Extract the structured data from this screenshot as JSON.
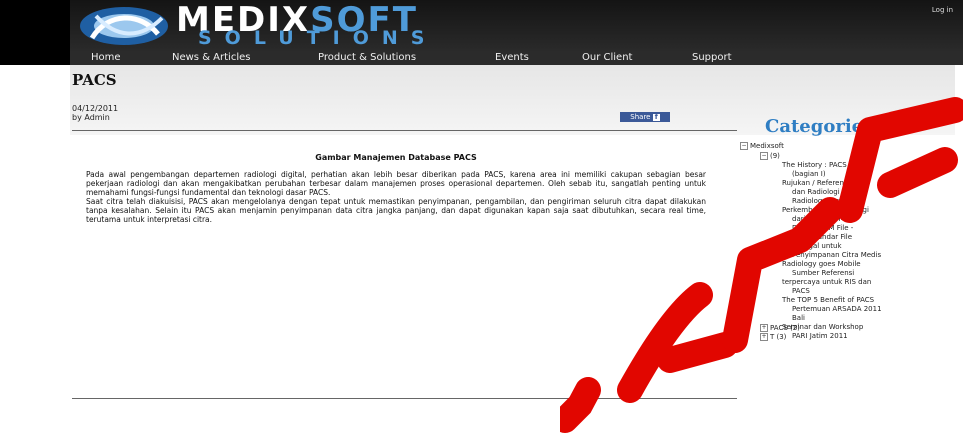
{
  "header": {
    "brand_part1": "MEDIX",
    "brand_part2": "SOFT",
    "brand_sub": "SOLUTIONS",
    "login_label": "Log in"
  },
  "nav": [
    "Home",
    "News & Articles",
    "Product & Solutions",
    "Events",
    "Our Client",
    "Support"
  ],
  "page": {
    "title": "PACS",
    "date": "04/12/2011",
    "author": "by Admin",
    "share_label": "Share"
  },
  "article": {
    "title": "Gambar Manajemen Database PACS",
    "paragraph1": "Pada awal pengembangan departemen radiologi digital, perhatian akan lebih besar diberikan pada PACS, karena area ini memiliki cakupan sebagian besar pekerjaan radiologi dan akan mengakibatkan perubahan terbesar dalam manajemen proses operasional departemen. Oleh sebab itu, sangatlah penting untuk memahami fungsi-fungsi fundamental dan teknologi dasar PACS.",
    "paragraph2": "Saat citra telah diakuisisi, PACS akan mengelolanya dengan tepat untuk memastikan penyimpanan, pengambilan, dan pengiriman seluruh citra dapat dilakukan tanpa kesalahan. Selain itu PACS akan menjamin penyimpanan data citra jangka panjang, dan dapat digunakan kapan saja saat dibutuhkan, secara real time, terutama untuk interpretasi citra."
  },
  "sidebar": {
    "title": "Categories",
    "tree": [
      {
        "label": "Medixsoft"
      },
      {
        "label": "(9)"
      },
      {
        "label": "The History : PACS"
      },
      {
        "label": "(bagian I)"
      },
      {
        "label": "Rujukan / Referensi PACS"
      },
      {
        "label": "dan Radiologi"
      },
      {
        "label": "Radiology Timeline :"
      },
      {
        "label": "Perkembangan Radiologi"
      },
      {
        "label": "dari Masa ke Masa"
      },
      {
        "label": "DICOM/DCM File -"
      },
      {
        "label": "Sebuah Standar File"
      },
      {
        "label": "Tunggal untuk"
      },
      {
        "label": "Penyimpanan Citra Medis"
      },
      {
        "label": "Radiology goes Mobile"
      },
      {
        "label": "Sumber Referensi"
      },
      {
        "label": "terpercaya untuk RIS dan"
      },
      {
        "label": "PACS"
      },
      {
        "label": "The TOP 5 Benefit of PACS"
      },
      {
        "label": "Pertemuan ARSADA 2011"
      },
      {
        "label": "Bali"
      },
      {
        "label": "Seminar dan Workshop"
      },
      {
        "label": "PARI Jatim 2011"
      },
      {
        "label": "PACS (2)"
      },
      {
        "label": "T (3)"
      }
    ]
  },
  "colors": {
    "header_bg": "#000000",
    "brand_accent": "#4f9bd9",
    "category_title": "#2f7ec3",
    "share_button": "#3b5998",
    "watermark": "#e10600"
  }
}
